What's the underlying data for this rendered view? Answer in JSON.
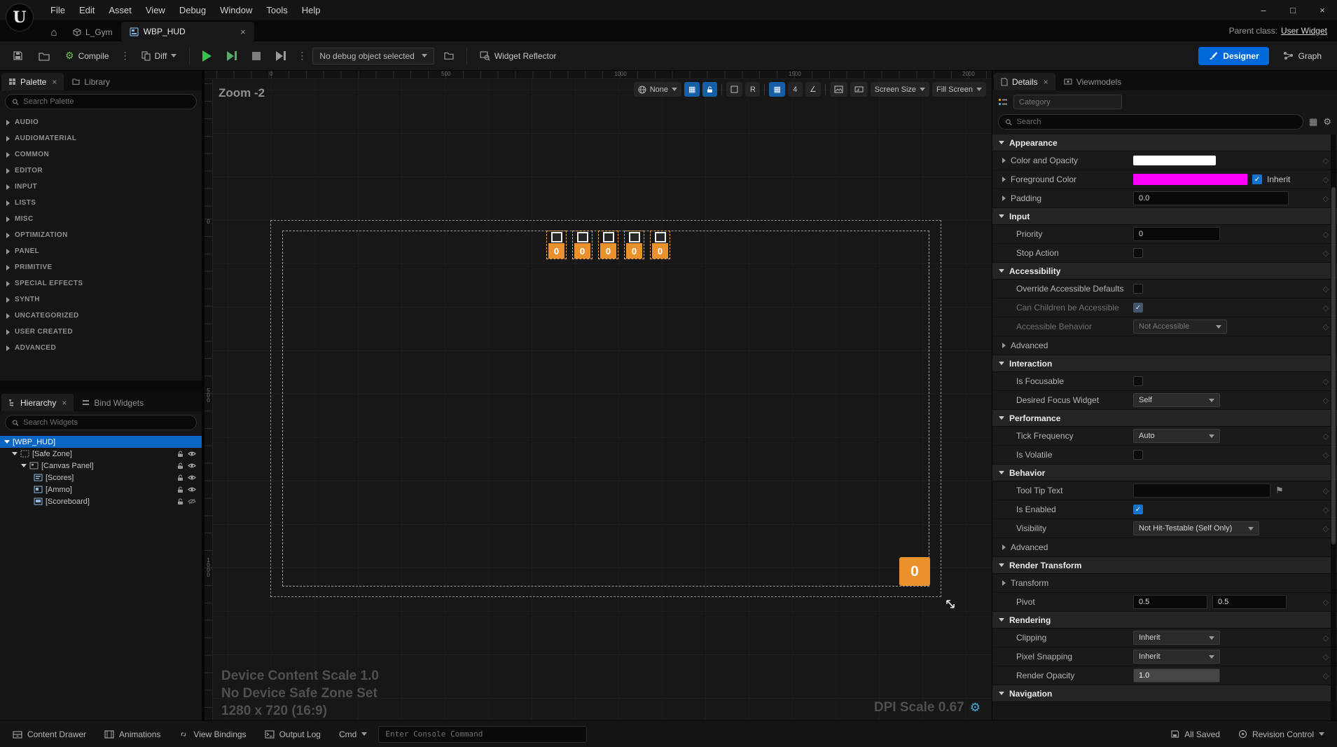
{
  "colors": {
    "accent": "#0069d9",
    "selection_orange": "#e8912d",
    "foreground_swatch": "#ff00ff",
    "color_swatch": "#ffffff"
  },
  "menubar": {
    "items": [
      "File",
      "Edit",
      "Asset",
      "View",
      "Debug",
      "Window",
      "Tools",
      "Help"
    ]
  },
  "window_controls": {
    "minimize": "–",
    "maximize": "□",
    "close": "×"
  },
  "tabbar": {
    "level_tab": "L_Gym",
    "active_tab": "WBP_HUD",
    "close": "×",
    "parent_class_label": "Parent class:",
    "parent_class_value": "User Widget"
  },
  "toolbar": {
    "compile": "Compile",
    "diff": "Diff",
    "debug_dropdown": "No debug object selected",
    "widget_reflector": "Widget Reflector",
    "designer": "Designer",
    "graph": "Graph"
  },
  "palette": {
    "tab": "Palette",
    "library_tab": "Library",
    "search_placeholder": "Search Palette",
    "categories": [
      "AUDIO",
      "AUDIOMATERIAL",
      "COMMON",
      "EDITOR",
      "INPUT",
      "LISTS",
      "MISC",
      "OPTIMIZATION",
      "PANEL",
      "PRIMITIVE",
      "SPECIAL EFFECTS",
      "SYNTH",
      "UNCATEGORIZED",
      "USER CREATED",
      "ADVANCED"
    ]
  },
  "hierarchy": {
    "tab": "Hierarchy",
    "bind_widgets_tab": "Bind Widgets",
    "search_placeholder": "Search Widgets",
    "items": [
      "[WBP_HUD]",
      "[Safe Zone]",
      "[Canvas Panel]",
      "[Scores]",
      "[Ammo]",
      "[Scoreboard]"
    ]
  },
  "canvas": {
    "zoom": "Zoom -2",
    "ruler_top": [
      "0",
      "500",
      "1000",
      "1500",
      "2000"
    ],
    "ruler_left": [
      "0",
      "500",
      "1000"
    ],
    "toolbar": {
      "none": "None",
      "r": "R",
      "grid_size": "4",
      "screen_size": "Screen Size",
      "fill_screen": "Fill Screen"
    },
    "ammo": [
      "0",
      "0",
      "0",
      "0",
      "0"
    ],
    "score": "0",
    "overlay": {
      "line1": "Device Content Scale 1.0",
      "line2": "No Device Safe Zone Set",
      "line3": "1280 x 720 (16:9)",
      "dpi": "DPI Scale 0.67"
    }
  },
  "details": {
    "tab": "Details",
    "viewmodels_tab": "Viewmodels",
    "category_placeholder": "Category",
    "search_placeholder": "Search",
    "appearance": {
      "title": "Appearance",
      "color_and_opacity": "Color and Opacity",
      "foreground_color": "Foreground Color",
      "inherit": "Inherit",
      "padding": "Padding",
      "padding_value": "0.0"
    },
    "input": {
      "title": "Input",
      "priority": "Priority",
      "priority_value": "0",
      "stop_action": "Stop Action"
    },
    "accessibility": {
      "title": "Accessibility",
      "override_accessible_defaults": "Override Accessible Defaults",
      "can_children_be_accessible": "Can Children be Accessible",
      "accessible_behavior": "Accessible Behavior",
      "accessible_behavior_value": "Not Accessible",
      "advanced": "Advanced"
    },
    "interaction": {
      "title": "Interaction",
      "is_focusable": "Is Focusable",
      "desired_focus_widget": "Desired Focus Widget",
      "desired_focus_widget_value": "Self"
    },
    "performance": {
      "title": "Performance",
      "tick_frequency": "Tick Frequency",
      "tick_frequency_value": "Auto",
      "is_volatile": "Is Volatile"
    },
    "behavior": {
      "title": "Behavior",
      "tool_tip_text": "Tool Tip Text",
      "is_enabled": "Is Enabled",
      "visibility": "Visibility",
      "visibility_value": "Not Hit-Testable (Self Only)",
      "advanced": "Advanced"
    },
    "render_transform": {
      "title": "Render Transform",
      "transform": "Transform",
      "pivot": "Pivot",
      "pivot_x": "0.5",
      "pivot_y": "0.5"
    },
    "rendering": {
      "title": "Rendering",
      "clipping": "Clipping",
      "clipping_value": "Inherit",
      "pixel_snapping": "Pixel Snapping",
      "pixel_snapping_value": "Inherit",
      "render_opacity": "Render Opacity",
      "render_opacity_value": "1.0"
    },
    "navigation": {
      "title": "Navigation"
    }
  },
  "statusbar": {
    "content_drawer": "Content Drawer",
    "animations": "Animations",
    "view_bindings": "View Bindings",
    "output_log": "Output Log",
    "cmd": "Cmd",
    "console_placeholder": "Enter Console Command",
    "all_saved": "All Saved",
    "revision_control": "Revision Control"
  }
}
